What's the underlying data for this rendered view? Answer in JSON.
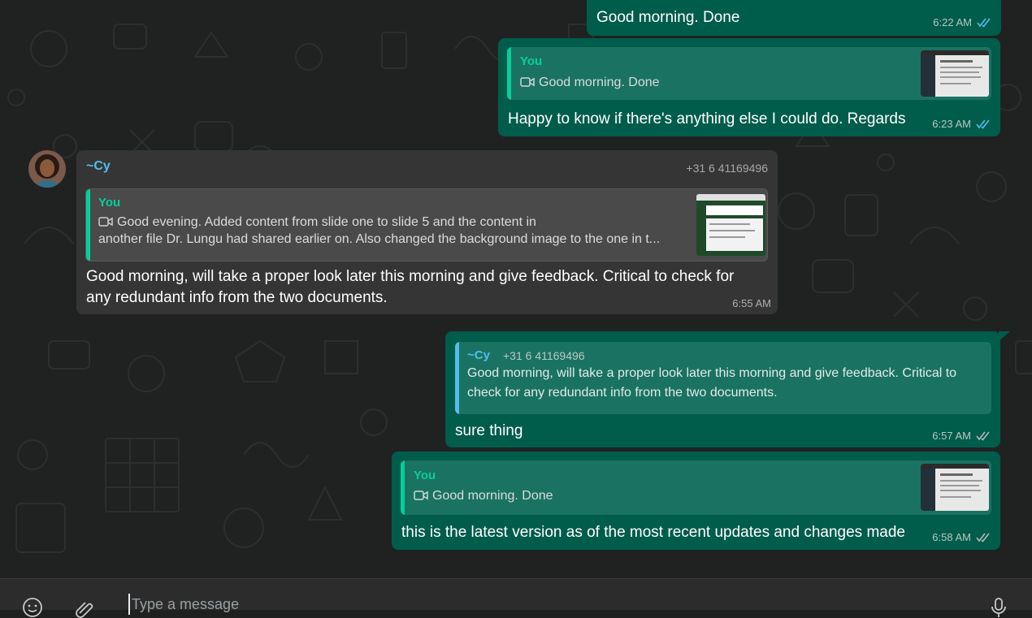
{
  "messages": [
    {
      "text": "Good morning. Done",
      "time": "6:22 AM"
    },
    {
      "quote": {
        "author": "You",
        "text": "Good morning. Done"
      },
      "text": "Happy to know if there's anything else I could do. Regards",
      "time": "6:23 AM"
    },
    {
      "sender": "~Cy",
      "phone": "+31 6 41169496",
      "quote": {
        "author": "You",
        "line1": "Good evening. Added content from slide one to slide 5 and the content in",
        "line2": "another file Dr. Lungu had shared earlier on. Also changed the background image to the one in t..."
      },
      "line1": "Good morning, will take a proper look later this morning and give feedback. Critical to check for",
      "line2": "any redundant info from the two documents.",
      "time": "6:55 AM"
    },
    {
      "quote": {
        "author": "~Cy",
        "phone": "+31 6 41169496",
        "line1": "Good morning, will take a proper look later this morning and give feedback. Critical to",
        "line2": "check for any redundant info from the two documents."
      },
      "text": "sure thing",
      "time": "6:57 AM"
    },
    {
      "quote": {
        "author": "You",
        "text": "Good morning. Done"
      },
      "text": "this is the latest version as of the most recent updates and changes made",
      "time": "6:58 AM"
    }
  ],
  "composer": {
    "placeholder": "Type a message"
  },
  "colors": {
    "outgoing_bubble": "#005c4b",
    "incoming_bubble": "#353535",
    "quote_you": "#06cf9c",
    "quote_contact": "#53bdeb",
    "tick_read": "#53bdeb"
  },
  "icons": [
    "emoji-icon",
    "attach-icon",
    "microphone-icon",
    "video-icon",
    "double-check-icon"
  ]
}
